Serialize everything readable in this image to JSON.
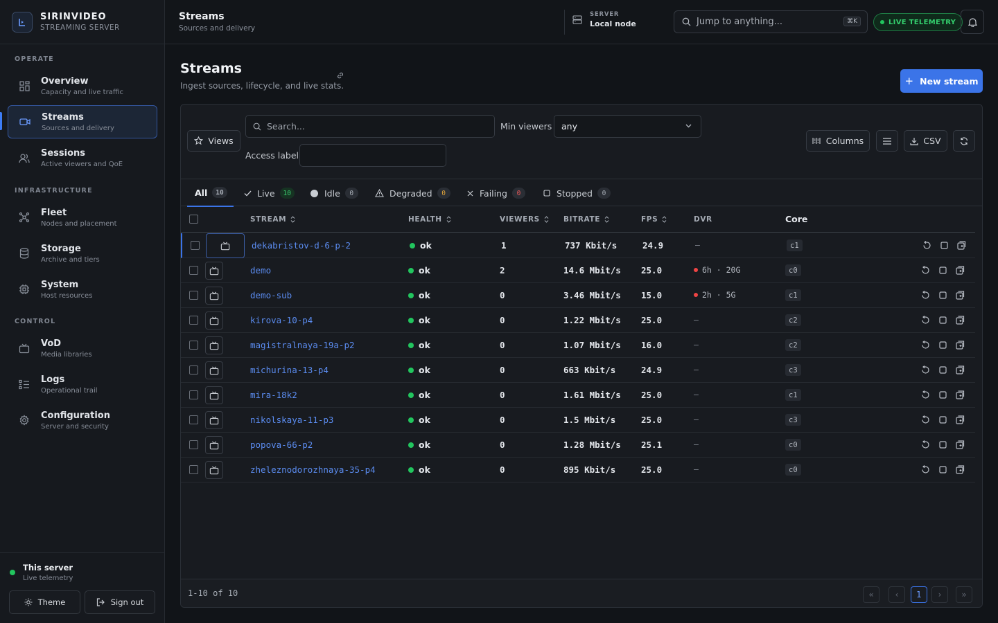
{
  "brand": {
    "name": "SIRINVIDEO",
    "subtitle": "STREAMING SERVER"
  },
  "sidebar": {
    "sections": [
      {
        "label": "OPERATE",
        "items": [
          {
            "label": "Overview",
            "sub": "Capacity and live traffic"
          },
          {
            "label": "Streams",
            "sub": "Sources and delivery",
            "active": true
          },
          {
            "label": "Sessions",
            "sub": "Active viewers and QoE"
          }
        ]
      },
      {
        "label": "INFRASTRUCTURE",
        "items": [
          {
            "label": "Fleet",
            "sub": "Nodes and placement"
          },
          {
            "label": "Storage",
            "sub": "Archive and tiers"
          },
          {
            "label": "System",
            "sub": "Host resources"
          }
        ]
      },
      {
        "label": "CONTROL",
        "items": [
          {
            "label": "VoD",
            "sub": "Media libraries"
          },
          {
            "label": "Logs",
            "sub": "Operational trail"
          },
          {
            "label": "Configuration",
            "sub": "Server and security"
          }
        ]
      }
    ],
    "footer": {
      "title": "This server",
      "sub": "Live telemetry",
      "theme_label": "Theme",
      "signout_label": "Sign out"
    }
  },
  "header": {
    "title": "Streams",
    "subtitle": "Sources and delivery",
    "server_label": "SERVER",
    "server_value": "Local node",
    "search_placeholder": "Jump to anything...",
    "shortcut": "⌘K",
    "telemetry_label": "LIVE TELEMETRY"
  },
  "main": {
    "title": "Streams",
    "subtitle": "Ingest sources, lifecycle, and live stats.",
    "new_button": "New stream",
    "toolbar": {
      "views_label": "Views",
      "search_placeholder": "Search...",
      "min_viewers_label": "Min viewers",
      "min_viewers_value": "any",
      "access_label": "Access label",
      "access_value": "",
      "columns_label": "Columns",
      "csv_label": "CSV"
    },
    "tabs": [
      {
        "label": "All",
        "count": "10"
      },
      {
        "label": "Live",
        "count": "10"
      },
      {
        "label": "Idle",
        "count": "0"
      },
      {
        "label": "Degraded",
        "count": "0"
      },
      {
        "label": "Failing",
        "count": "0"
      },
      {
        "label": "Stopped",
        "count": "0"
      }
    ],
    "columns": [
      "STREAM",
      "HEALTH",
      "VIEWERS",
      "BITRATE",
      "FPS",
      "DVR",
      "Core"
    ],
    "rows": [
      {
        "name": "dekabristov-d-6-p-2",
        "health": "ok",
        "viewers": "1",
        "bitrate": "737 Kbit/s",
        "fps": "24.9",
        "dvr": "—",
        "core": "c1"
      },
      {
        "name": "demo",
        "health": "ok",
        "viewers": "2",
        "bitrate": "14.6 Mbit/s",
        "fps": "25.0",
        "dvr": "6h · 20G",
        "core": "c0"
      },
      {
        "name": "demo-sub",
        "health": "ok",
        "viewers": "0",
        "bitrate": "3.46 Mbit/s",
        "fps": "15.0",
        "dvr": "2h · 5G",
        "core": "c1"
      },
      {
        "name": "kirova-10-p4",
        "health": "ok",
        "viewers": "0",
        "bitrate": "1.22 Mbit/s",
        "fps": "25.0",
        "dvr": "—",
        "core": "c2"
      },
      {
        "name": "magistralnaya-19a-p2",
        "health": "ok",
        "viewers": "0",
        "bitrate": "1.07 Mbit/s",
        "fps": "16.0",
        "dvr": "—",
        "core": "c2"
      },
      {
        "name": "michurina-13-p4",
        "health": "ok",
        "viewers": "0",
        "bitrate": "663 Kbit/s",
        "fps": "24.9",
        "dvr": "—",
        "core": "c3"
      },
      {
        "name": "mira-18k2",
        "health": "ok",
        "viewers": "0",
        "bitrate": "1.61 Mbit/s",
        "fps": "25.0",
        "dvr": "—",
        "core": "c1"
      },
      {
        "name": "nikolskaya-11-p3",
        "health": "ok",
        "viewers": "0",
        "bitrate": "1.5 Mbit/s",
        "fps": "25.0",
        "dvr": "—",
        "core": "c3"
      },
      {
        "name": "popova-66-p2",
        "health": "ok",
        "viewers": "0",
        "bitrate": "1.28 Mbit/s",
        "fps": "25.1",
        "dvr": "—",
        "core": "c0"
      },
      {
        "name": "zheleznodorozhnaya-35-p4",
        "health": "ok",
        "viewers": "0",
        "bitrate": "895 Kbit/s",
        "fps": "25.0",
        "dvr": "—",
        "core": "c0"
      }
    ],
    "pagination": {
      "summary": "1-10 of 10",
      "current": "1"
    }
  },
  "colors": {
    "accent": "#3b74e8",
    "ok": "#22c55e",
    "dvr": "#ef4444",
    "link": "#5b8cf0"
  }
}
